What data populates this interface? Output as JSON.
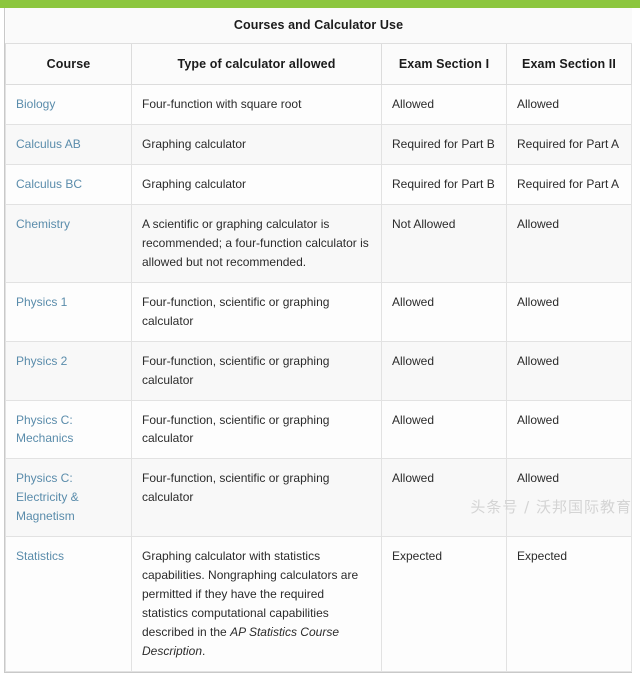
{
  "theme": {
    "accent_green": "#8cc63e",
    "link_blue": "#5a8cab",
    "text_dark": "#2b2b2b",
    "border_gray": "#e2e2e2"
  },
  "table": {
    "title": "Courses and Calculator Use",
    "columns": [
      "Course",
      "Type of calculator allowed",
      "Exam Section I",
      "Exam Section II"
    ],
    "rows": [
      {
        "course": "Biology",
        "calculator": "Four-function with square root",
        "section1": "Allowed",
        "section2": "Allowed"
      },
      {
        "course": "Calculus AB",
        "calculator": "Graphing calculator",
        "section1": "Required for Part B",
        "section2": "Required for Part A"
      },
      {
        "course": "Calculus BC",
        "calculator": "Graphing calculator",
        "section1": "Required for Part B",
        "section2": "Required for Part A"
      },
      {
        "course": "Chemistry",
        "calculator": "A scientific or graphing calculator is recommended; a four-function calculator is allowed but not recommended.",
        "section1": "Not Allowed",
        "section2": "Allowed"
      },
      {
        "course": "Physics 1",
        "calculator": "Four-function, scientific or graphing calculator",
        "section1": "Allowed",
        "section2": "Allowed"
      },
      {
        "course": "Physics 2",
        "calculator": "Four-function, scientific or graphing calculator",
        "section1": "Allowed",
        "section2": "Allowed"
      },
      {
        "course": "Physics C: Mechanics",
        "calculator": "Four-function, scientific or graphing calculator",
        "section1": "Allowed",
        "section2": "Allowed"
      },
      {
        "course": "Physics C: Electricity & Magnetism",
        "calculator": "Four-function, scientific or graphing calculator",
        "section1": "Allowed",
        "section2": "Allowed"
      },
      {
        "course": "Statistics",
        "calculator_prefix": "Graphing calculator with statistics capabilities. Nongraphing calculators are permitted if they have the required statistics computational capabilities described in the ",
        "calculator_italic": "AP Statistics Course Description",
        "calculator_suffix": ".",
        "section1": "Expected",
        "section2": "Expected"
      }
    ]
  },
  "watermark": {
    "text": "头条号 / 沃邦国际教育"
  }
}
